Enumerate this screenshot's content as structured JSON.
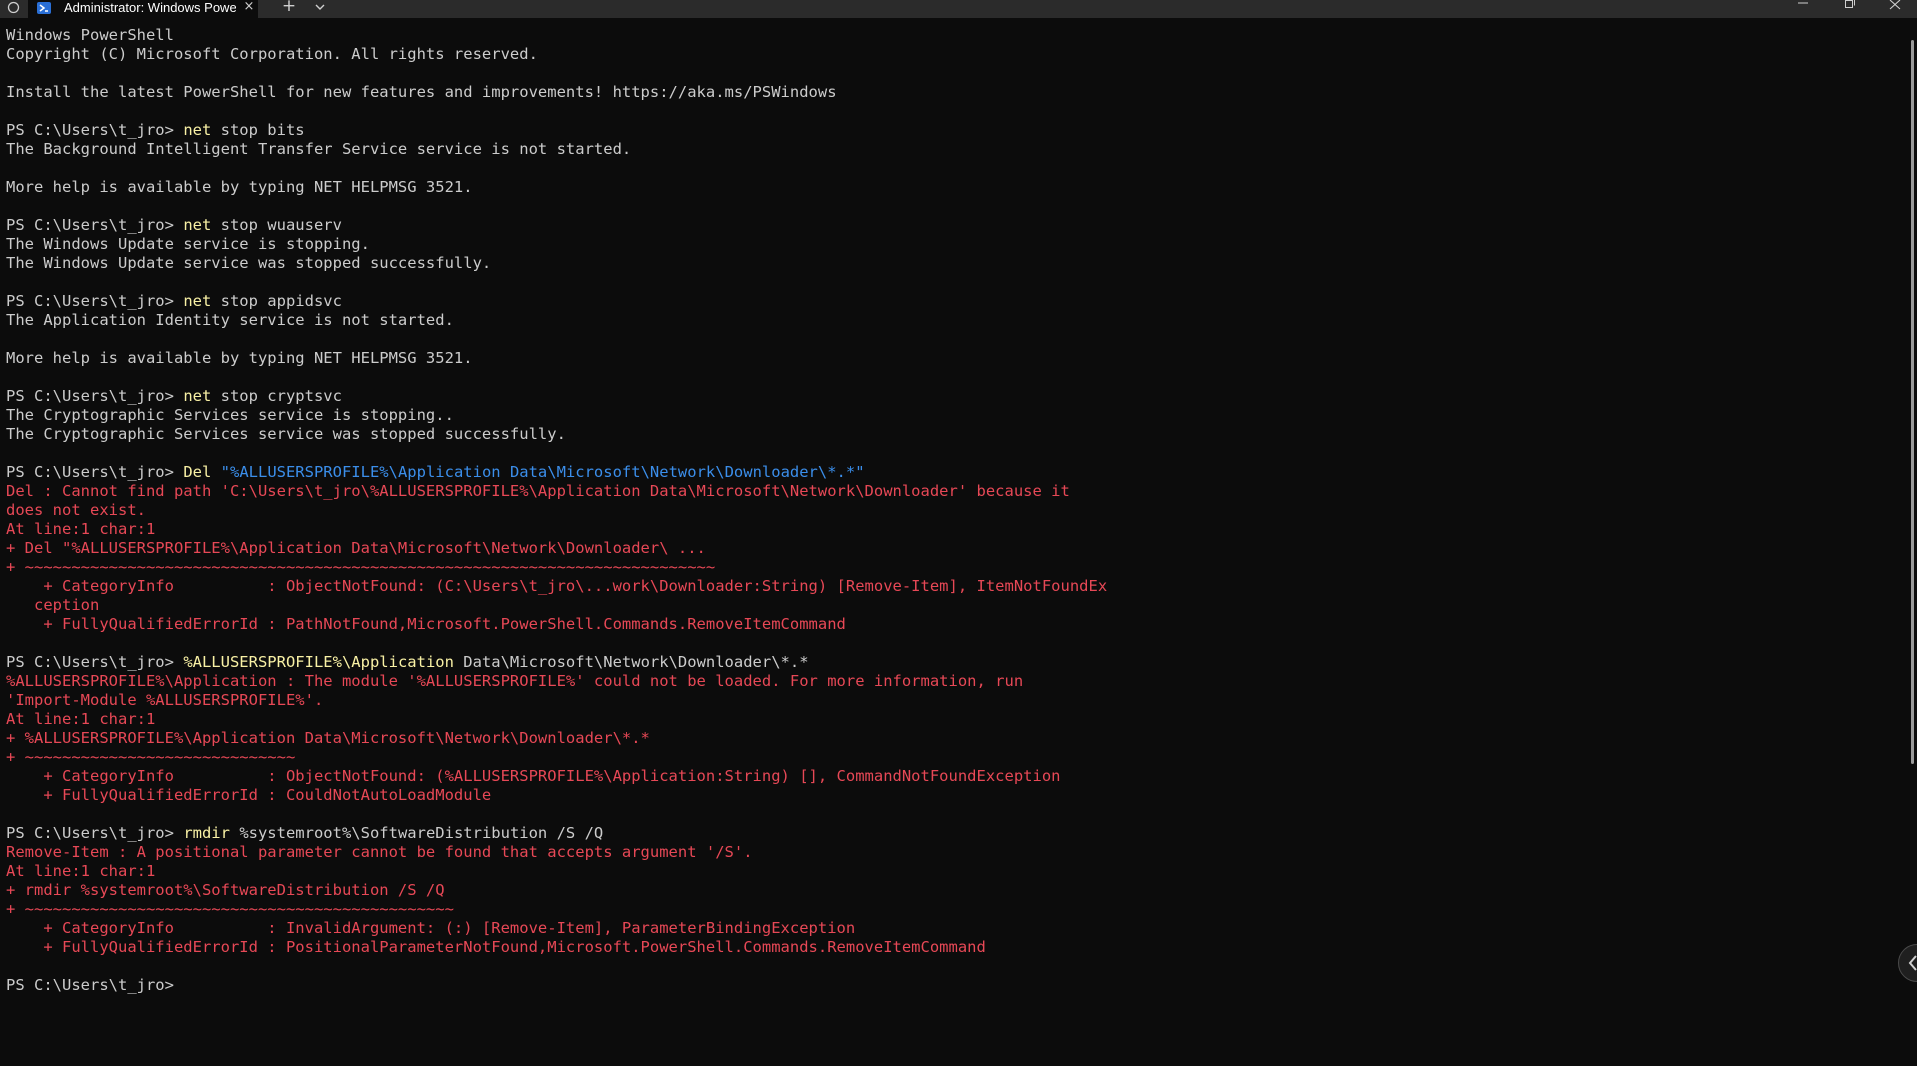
{
  "window": {
    "tab_title": "Administrator: Windows PowerShell",
    "new_tab_label": "+",
    "close_tab_label": "×"
  },
  "icons": {
    "system_menu": "circle-icon",
    "tab": "powershell-icon",
    "dropdown": "chevron-down-icon",
    "minimize": "minimize-icon",
    "maximize": "maximize-icon",
    "close": "close-icon"
  },
  "colors": {
    "background": "#0c0c0c",
    "text": "#cccccc",
    "command": "#f9f1a5",
    "string": "#3b8eea",
    "error": "#e74856",
    "titlebar": "#2b2b2b"
  },
  "terminal": {
    "lines": [
      [
        {
          "t": "Windows PowerShell",
          "c": "out"
        }
      ],
      [
        {
          "t": "Copyright (C) Microsoft Corporation. All rights reserved.",
          "c": "out"
        }
      ],
      [
        {
          "t": "",
          "c": "out"
        }
      ],
      [
        {
          "t": "Install the latest PowerShell for new features and improvements! https://aka.ms/PSWindows",
          "c": "out"
        }
      ],
      [
        {
          "t": "",
          "c": "out"
        }
      ],
      [
        {
          "t": "PS C:\\Users\\t_jro> ",
          "c": "out"
        },
        {
          "t": "net",
          "c": "cmd"
        },
        {
          "t": " stop bits",
          "c": "out"
        }
      ],
      [
        {
          "t": "The Background Intelligent Transfer Service service is not started.",
          "c": "out"
        }
      ],
      [
        {
          "t": "",
          "c": "out"
        }
      ],
      [
        {
          "t": "More help is available by typing NET HELPMSG 3521.",
          "c": "out"
        }
      ],
      [
        {
          "t": "",
          "c": "out"
        }
      ],
      [
        {
          "t": "PS C:\\Users\\t_jro> ",
          "c": "out"
        },
        {
          "t": "net",
          "c": "cmd"
        },
        {
          "t": " stop wuauserv",
          "c": "out"
        }
      ],
      [
        {
          "t": "The Windows Update service is stopping.",
          "c": "out"
        }
      ],
      [
        {
          "t": "The Windows Update service was stopped successfully.",
          "c": "out"
        }
      ],
      [
        {
          "t": "",
          "c": "out"
        }
      ],
      [
        {
          "t": "PS C:\\Users\\t_jro> ",
          "c": "out"
        },
        {
          "t": "net",
          "c": "cmd"
        },
        {
          "t": " stop appidsvc",
          "c": "out"
        }
      ],
      [
        {
          "t": "The Application Identity service is not started.",
          "c": "out"
        }
      ],
      [
        {
          "t": "",
          "c": "out"
        }
      ],
      [
        {
          "t": "More help is available by typing NET HELPMSG 3521.",
          "c": "out"
        }
      ],
      [
        {
          "t": "",
          "c": "out"
        }
      ],
      [
        {
          "t": "PS C:\\Users\\t_jro> ",
          "c": "out"
        },
        {
          "t": "net",
          "c": "cmd"
        },
        {
          "t": " stop cryptsvc",
          "c": "out"
        }
      ],
      [
        {
          "t": "The Cryptographic Services service is stopping..",
          "c": "out"
        }
      ],
      [
        {
          "t": "The Cryptographic Services service was stopped successfully.",
          "c": "out"
        }
      ],
      [
        {
          "t": "",
          "c": "out"
        }
      ],
      [
        {
          "t": "PS C:\\Users\\t_jro> ",
          "c": "out"
        },
        {
          "t": "Del",
          "c": "cmd"
        },
        {
          "t": " ",
          "c": "out"
        },
        {
          "t": "\"%ALLUSERSPROFILE%\\Application Data\\Microsoft\\Network\\Downloader\\*.*\"",
          "c": "str"
        }
      ],
      [
        {
          "t": "Del : Cannot find path 'C:\\Users\\t_jro\\%ALLUSERSPROFILE%\\Application Data\\Microsoft\\Network\\Downloader' because it",
          "c": "err"
        }
      ],
      [
        {
          "t": "does not exist.",
          "c": "err"
        }
      ],
      [
        {
          "t": "At line:1 char:1",
          "c": "err"
        }
      ],
      [
        {
          "t": "+ Del \"%ALLUSERSPROFILE%\\Application Data\\Microsoft\\Network\\Downloader\\ ...",
          "c": "err"
        }
      ],
      [
        {
          "t": "+ ~~~~~~~~~~~~~~~~~~~~~~~~~~~~~~~~~~~~~~~~~~~~~~~~~~~~~~~~~~~~~~~~~~~~~~~~~~",
          "c": "err"
        }
      ],
      [
        {
          "t": "    + CategoryInfo          : ObjectNotFound: (C:\\Users\\t_jro\\...work\\Downloader:String) [Remove-Item], ItemNotFoundEx",
          "c": "err"
        }
      ],
      [
        {
          "t": "   ception",
          "c": "err"
        }
      ],
      [
        {
          "t": "    + FullyQualifiedErrorId : PathNotFound,Microsoft.PowerShell.Commands.RemoveItemCommand",
          "c": "err"
        }
      ],
      [
        {
          "t": "",
          "c": "out"
        }
      ],
      [
        {
          "t": "PS C:\\Users\\t_jro> ",
          "c": "out"
        },
        {
          "t": "%ALLUSERSPROFILE%\\Application",
          "c": "cmd"
        },
        {
          "t": " Data\\Microsoft\\Network\\Downloader\\*.*",
          "c": "out"
        }
      ],
      [
        {
          "t": "%ALLUSERSPROFILE%\\Application : The module '%ALLUSERSPROFILE%' could not be loaded. For more information, run",
          "c": "err"
        }
      ],
      [
        {
          "t": "'Import-Module %ALLUSERSPROFILE%'.",
          "c": "err"
        }
      ],
      [
        {
          "t": "At line:1 char:1",
          "c": "err"
        }
      ],
      [
        {
          "t": "+ %ALLUSERSPROFILE%\\Application Data\\Microsoft\\Network\\Downloader\\*.*",
          "c": "err"
        }
      ],
      [
        {
          "t": "+ ~~~~~~~~~~~~~~~~~~~~~~~~~~~~~",
          "c": "err"
        }
      ],
      [
        {
          "t": "    + CategoryInfo          : ObjectNotFound: (%ALLUSERSPROFILE%\\Application:String) [], CommandNotFoundException",
          "c": "err"
        }
      ],
      [
        {
          "t": "    + FullyQualifiedErrorId : CouldNotAutoLoadModule",
          "c": "err"
        }
      ],
      [
        {
          "t": "",
          "c": "out"
        }
      ],
      [
        {
          "t": "PS C:\\Users\\t_jro> ",
          "c": "out"
        },
        {
          "t": "rmdir",
          "c": "cmd"
        },
        {
          "t": " %systemroot%\\SoftwareDistribution /S /Q",
          "c": "out"
        }
      ],
      [
        {
          "t": "Remove-Item : A positional parameter cannot be found that accepts argument '/S'.",
          "c": "err"
        }
      ],
      [
        {
          "t": "At line:1 char:1",
          "c": "err"
        }
      ],
      [
        {
          "t": "+ rmdir %systemroot%\\SoftwareDistribution /S /Q",
          "c": "err"
        }
      ],
      [
        {
          "t": "+ ~~~~~~~~~~~~~~~~~~~~~~~~~~~~~~~~~~~~~~~~~~~~~~",
          "c": "err"
        }
      ],
      [
        {
          "t": "    + CategoryInfo          : InvalidArgument: (:) [Remove-Item], ParameterBindingException",
          "c": "err"
        }
      ],
      [
        {
          "t": "    + FullyQualifiedErrorId : PositionalParameterNotFound,Microsoft.PowerShell.Commands.RemoveItemCommand",
          "c": "err"
        }
      ],
      [
        {
          "t": "",
          "c": "out"
        }
      ],
      [
        {
          "t": "PS C:\\Users\\t_jro> ",
          "c": "out"
        }
      ]
    ]
  }
}
